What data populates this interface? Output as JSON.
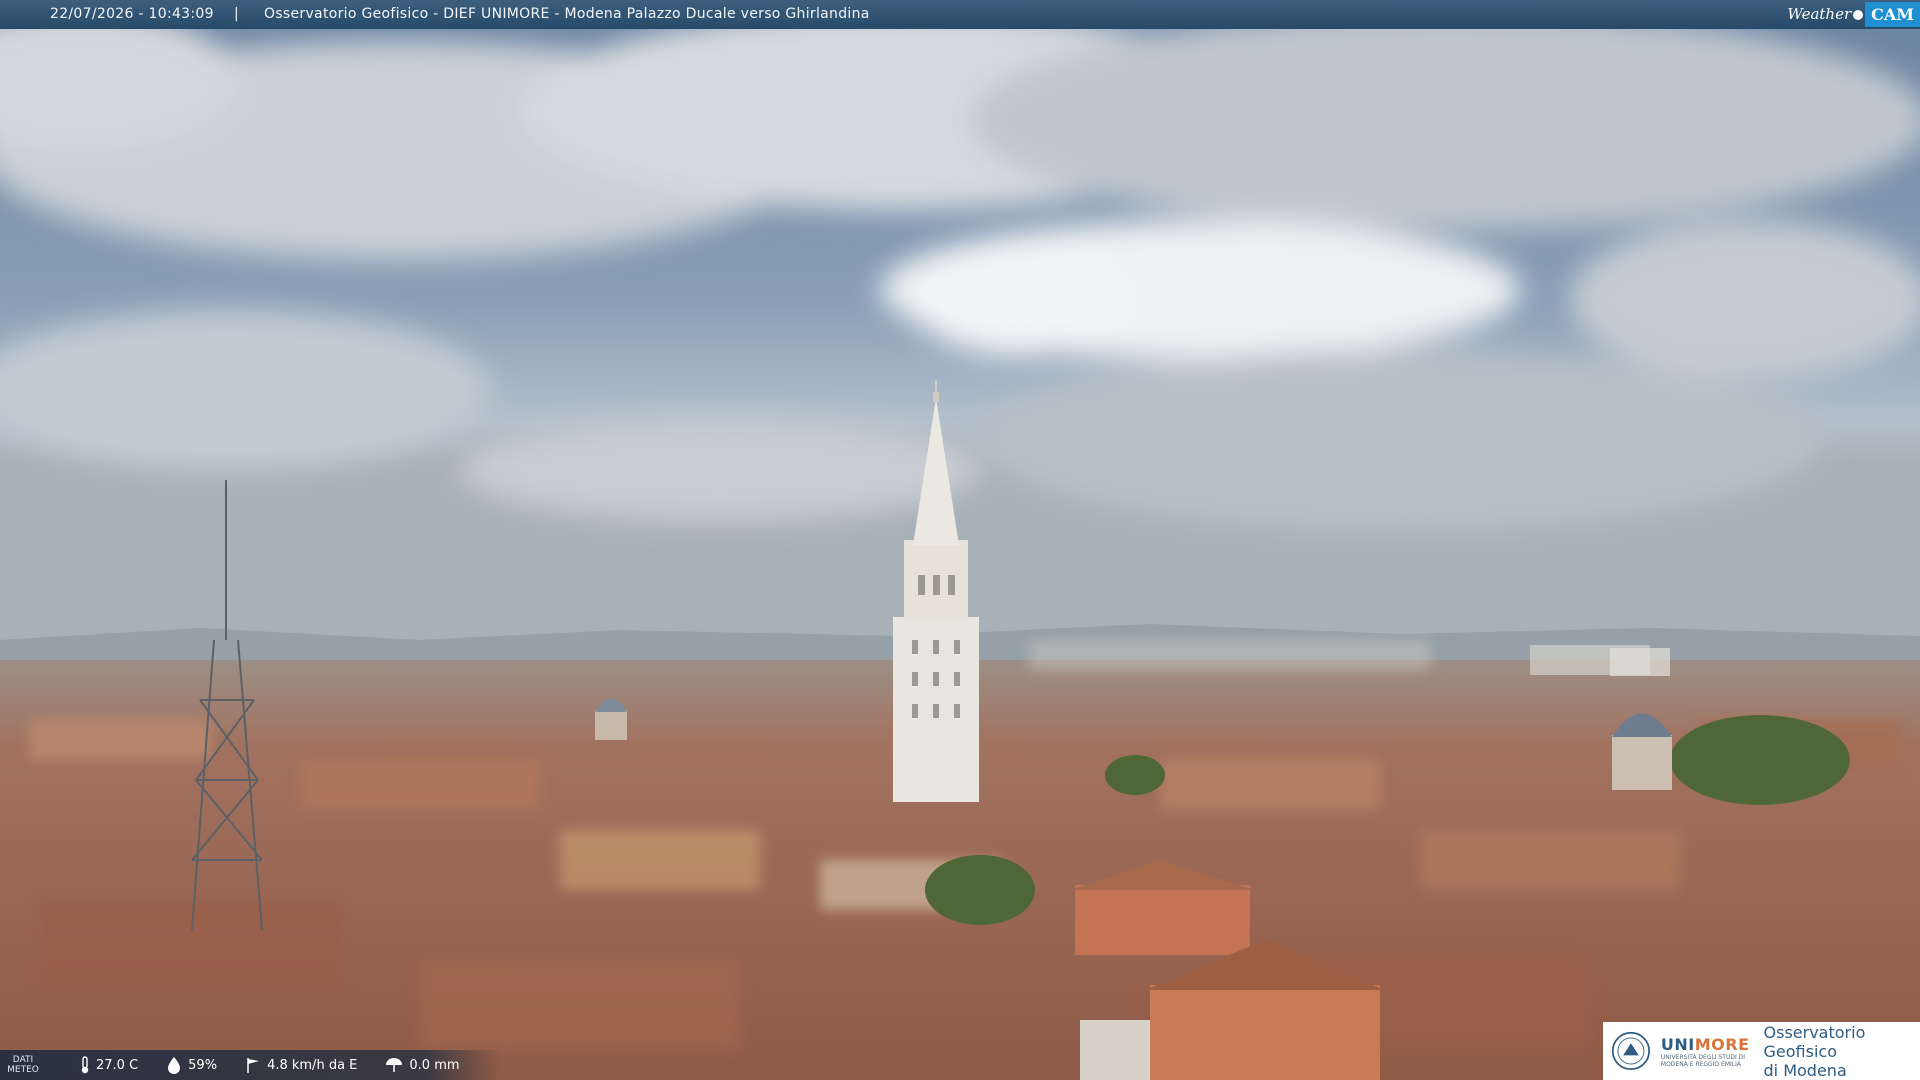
{
  "overlay": {
    "timestamp": "22/07/2026 - 10:43:09",
    "separator": "|",
    "title": "Osservatorio Geofisico - DIEF UNIMORE - Modena Palazzo Ducale verso Ghirlandina"
  },
  "brand": {
    "weather": "Weather",
    "cam": "CAM"
  },
  "weather_bar": {
    "label_line1": "DATI",
    "label_line2": "METEO",
    "temperature": "27.0 C",
    "humidity": "59%",
    "wind": "4.8 km/h da E",
    "rain": "0.0 mm",
    "icons": [
      "thermometer-icon",
      "humidity-icon",
      "wind-icon",
      "rain-icon"
    ]
  },
  "logo": {
    "uni_prefix": "UNI",
    "uni_suffix": "MORE",
    "uni_sub_line1": "UNIVERSITÀ DEGLI STUDI DI",
    "uni_sub_line2": "MODENA E REGGIO EMILIA",
    "osservatorio_line1": "Osservatorio Geofisico",
    "osservatorio_line2": "di Modena"
  },
  "colors": {
    "sky_top": "#6f89a6",
    "cloud": "#e9ecef",
    "roof": "#a8684a",
    "tower": "#e8e4dc",
    "accent": "#1f8fd1"
  }
}
